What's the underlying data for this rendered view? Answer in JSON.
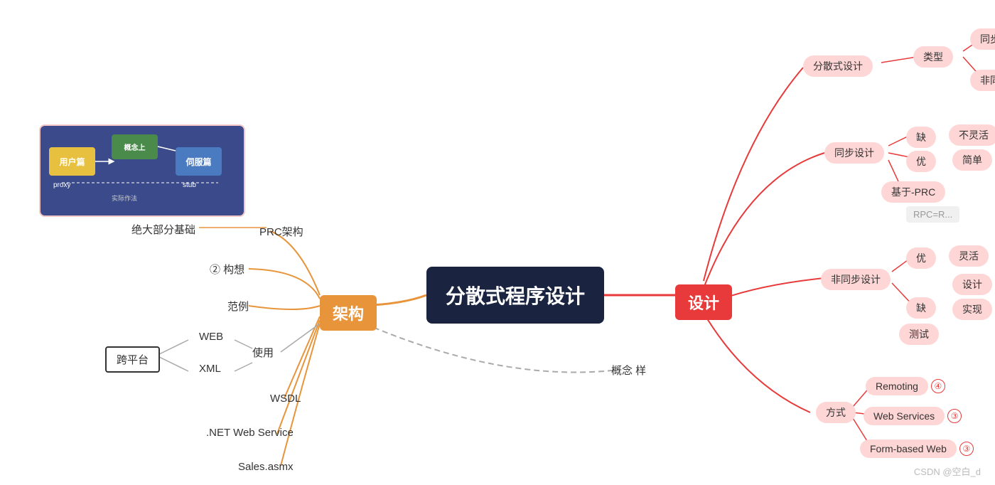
{
  "title": "分散式程序设计",
  "main_node": "分散式程序设计",
  "nodes": {
    "main": "分散式程序设计",
    "jiagou": "架构",
    "sheji": "设计",
    "kuapingtai": "跨平台",
    "prc": "PRC架构",
    "goucheng": "② 构想",
    "fanli": "范例",
    "juedashufen": "绝大部分基础",
    "wsdl": "WSDL",
    "net_web": ".NET Web Service",
    "sales": "Sales.asmx",
    "web": "WEB",
    "xml": "XML",
    "shiyong": "使用",
    "gainian": "概念 样",
    "fangshi": "方式",
    "remoting": "Remoting",
    "webservices": "Web Services",
    "formbased": "Form-based Web",
    "fensan_sheji": "分散式设计",
    "leixing": "类型",
    "tongbu": "同步",
    "feitongbu_label": "非同",
    "tongbu_sheji": "同步设计",
    "que_tongbu": "缺",
    "you_tongbu": "优",
    "bulihuo": "不灵活",
    "jiandan": "简单",
    "jiyu_prc": "基于-PRC",
    "rpc_label": "RPC=R...",
    "feitongbu_sheji": "非同步设计",
    "you_fei": "优",
    "que_fei": "缺",
    "linghuo": "灵活",
    "sheji_node": "设计",
    "shixian": "实现",
    "ceshi": "测试",
    "remoting_badge": "④",
    "webservices_badge": "③",
    "formbased_badge": "③"
  },
  "colors": {
    "main_bg": "#1a2340",
    "jiagou_bg": "#e8943a",
    "sheji_bg": "#e83a3a",
    "pink_bg": "#ffd6d6",
    "line_orange": "#e8943a",
    "line_red": "#e83a3a",
    "line_dashed": "#aaa"
  },
  "watermark": "CSDN @空白_d"
}
